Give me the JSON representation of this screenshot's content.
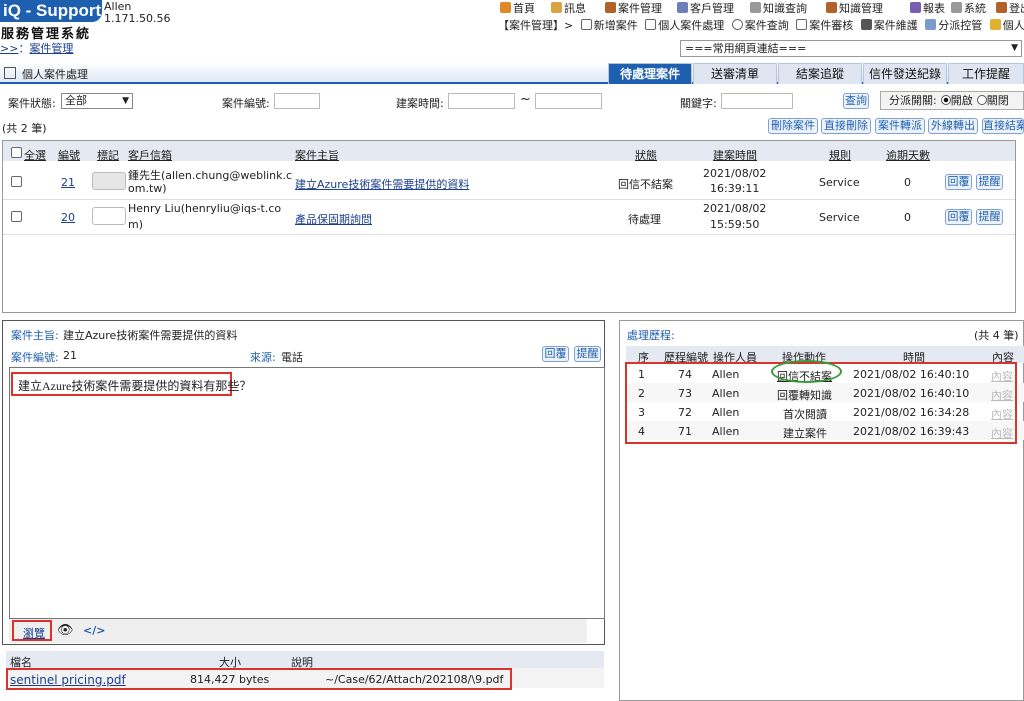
{
  "header": {
    "logo": "iQ - Support",
    "system_name": "服務管理系統",
    "user_name": "Allen",
    "version": "1.171.50.56",
    "breadcrumb_prefix": ">>",
    "breadcrumb": "案件管理"
  },
  "top_nav": [
    {
      "label": "首頁",
      "icon": "home-icon",
      "color": "#e0892b"
    },
    {
      "label": "訊息",
      "icon": "mail-icon",
      "color": "#d9a441"
    },
    {
      "label": "案件管理",
      "icon": "case-icon",
      "color": "#b0622a"
    },
    {
      "label": "客戶管理",
      "icon": "customer-icon",
      "color": "#6b7fb8"
    },
    {
      "label": "知識查詢",
      "icon": "search-icon",
      "color": "#777777"
    },
    {
      "label": "知識管理",
      "icon": "book-icon",
      "color": "#b0622a"
    },
    {
      "label": "報表",
      "icon": "report-icon",
      "color": "#7a5fb0"
    },
    {
      "label": "系統",
      "icon": "system-icon",
      "color": "#777777"
    },
    {
      "label": "登出",
      "icon": "logout-icon",
      "color": "#b0622a"
    }
  ],
  "sub_nav": {
    "section": "【案件管理】>",
    "items": [
      "新增案件",
      "個人案件處理",
      "案件查詢",
      "案件審核",
      "案件維護",
      "分派控管",
      "個人設定"
    ]
  },
  "quick_links": "===常用網頁連結===",
  "page_title": "個人案件處理",
  "tabs": [
    {
      "label": "待處理案件",
      "active": true
    },
    {
      "label": "送審清單",
      "active": false
    },
    {
      "label": "結案追蹤",
      "active": false
    },
    {
      "label": "信件發送紀錄",
      "active": false
    },
    {
      "label": "工作提醒",
      "active": false
    }
  ],
  "filters": {
    "status_label": "案件狀態:",
    "status_value": "全部",
    "case_no_label": "案件編號:",
    "created_label": "建案時間:",
    "range_sep": "~",
    "keyword_label": "關鍵字:",
    "query_button": "查詢",
    "dispatch_label": "分派開關:",
    "dispatch_on": "開啟",
    "dispatch_off": "關閉"
  },
  "list": {
    "count": "(共 2 筆)",
    "actions": [
      "刪除案件",
      "直接刪除",
      "案件轉派",
      "外線轉出",
      "直接結案"
    ],
    "columns": [
      "全選",
      "編號",
      "標記",
      "客戶信箱",
      "案件主旨",
      "狀態",
      "建案時間",
      "規則",
      "逾期天數"
    ],
    "rows": [
      {
        "id": "21",
        "email_1": "鍾先生(allen.chung@weblink.c",
        "email_2": "om.tw)",
        "subject": "建立Azure技術案件需要提供的資料",
        "status": "回信不結案",
        "date": "2021/08/02",
        "time": "16:39:11",
        "rule": "Service",
        "overdue": "0",
        "reply": "回覆",
        "remind": "提醒"
      },
      {
        "id": "20",
        "email_1": "Henry Liu(henryliu@iqs-t.co",
        "email_2": "m)",
        "subject": "產品保固期詢問",
        "status": "待處理",
        "date": "2021/08/02",
        "time": "15:59:50",
        "rule": "Service",
        "overdue": "0",
        "reply": "回覆",
        "remind": "提醒"
      }
    ]
  },
  "detail": {
    "subject_label": "案件主旨:",
    "subject": "建立Azure技術案件需要提供的資料",
    "case_no_label": "案件編號:",
    "case_no": "21",
    "source_label": "來源:",
    "source": "電話",
    "reply": "回覆",
    "remind": "提醒",
    "content": "建立Azure技術案件需要提供的資料有那些？",
    "browse": "瀏覽"
  },
  "attachments": {
    "columns": [
      "檔名",
      "大小",
      "說明"
    ],
    "rows": [
      {
        "name": "sentinel pricing.pdf",
        "size": "814,427 bytes",
        "note": "~/Case/62/Attach/202108/\\9.pdf"
      }
    ]
  },
  "history": {
    "title": "處理歷程:",
    "count": "(共 4 筆)",
    "columns": [
      "序",
      "歷程編號",
      "操作人員",
      "操作動作",
      "時間",
      "內容"
    ],
    "rows": [
      {
        "seq": "1",
        "hid": "74",
        "user": "Allen",
        "action": "回信不結案",
        "time": "2021/08/02 16:40:10",
        "content": "內容"
      },
      {
        "seq": "2",
        "hid": "73",
        "user": "Allen",
        "action": "回覆轉知識",
        "time": "2021/08/02 16:40:10",
        "content": "內容"
      },
      {
        "seq": "3",
        "hid": "72",
        "user": "Allen",
        "action": "首次閱讀",
        "time": "2021/08/02 16:34:28",
        "content": "內容"
      },
      {
        "seq": "4",
        "hid": "71",
        "user": "Allen",
        "action": "建立案件",
        "time": "2021/08/02 16:39:43",
        "content": "內容"
      }
    ]
  }
}
